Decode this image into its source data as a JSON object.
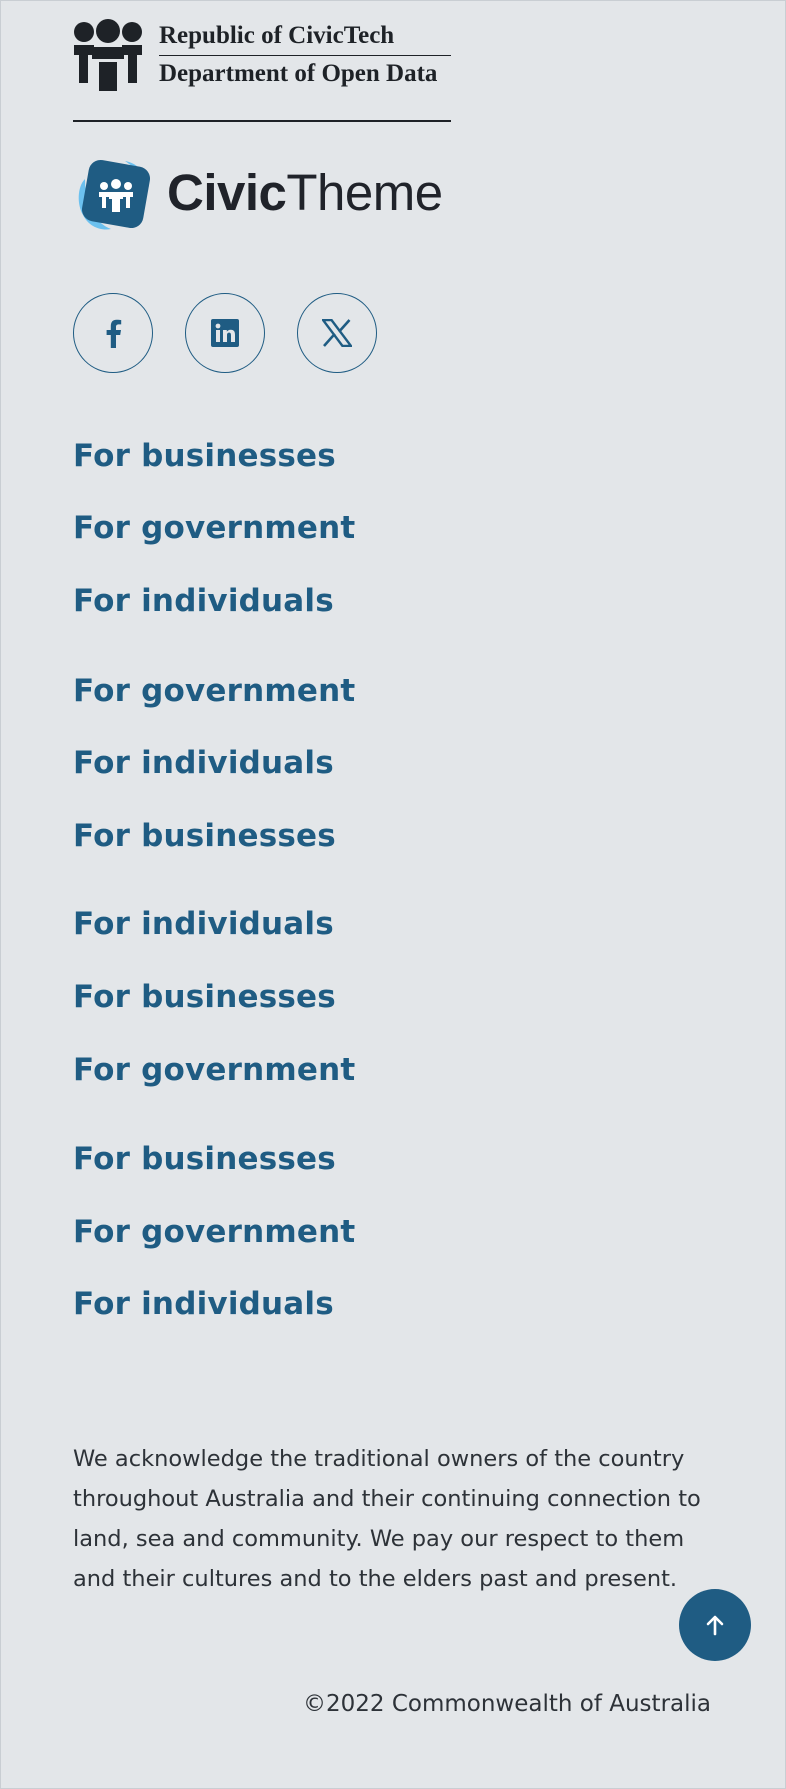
{
  "government": {
    "line1": "Republic of CivicTech",
    "line2": "Department of Open Data"
  },
  "brand": {
    "bold": "Civic",
    "light": "Theme"
  },
  "social": [
    {
      "name": "Facebook",
      "icon": "facebook-icon"
    },
    {
      "name": "LinkedIn",
      "icon": "linkedin-icon"
    },
    {
      "name": "X",
      "icon": "x-icon"
    }
  ],
  "nav_groups": [
    [
      "For businesses",
      "For government",
      "For individuals"
    ],
    [
      "For government",
      "For individuals",
      "For businesses"
    ],
    [
      "For individuals",
      "For businesses",
      "For government"
    ],
    [
      "For businesses",
      "For government",
      "For individuals"
    ]
  ],
  "acknowledgement": "We acknowledge the traditional owners of the country throughout Australia and their continuing connection to land, sea and community. We pay our respect to them and their cultures and to the elders past and present.",
  "copyright": "©2022 Commonwealth of Australia",
  "back_to_top": {
    "icon": "arrow-up-icon"
  },
  "colors": {
    "background": "#e3e6e9",
    "accent": "#1f5c83",
    "text": "#2d3238"
  }
}
